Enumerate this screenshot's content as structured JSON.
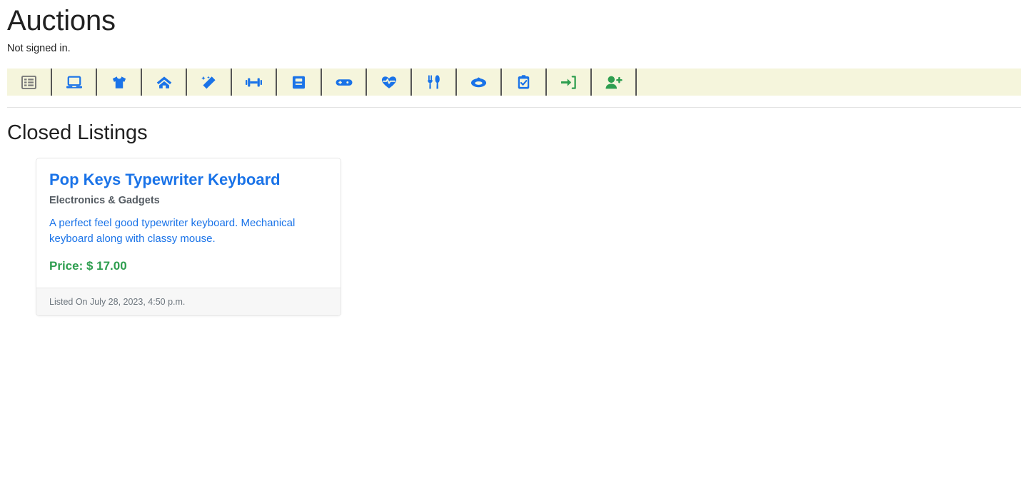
{
  "header": {
    "title": "Auctions",
    "auth_status": "Not signed in."
  },
  "navbar": {
    "background_color": "#f5f5dc",
    "divider_color": "#555555",
    "items": [
      {
        "icon": "list-alt-icon",
        "name": "nav-all-listings",
        "color": "#7a7a7a",
        "label": "All Listings"
      },
      {
        "icon": "laptop-icon",
        "name": "nav-electronics",
        "color": "#1a73e8",
        "label": "Electronics & Gadgets"
      },
      {
        "icon": "tshirt-icon",
        "name": "nav-fashion",
        "color": "#1a73e8",
        "label": "Fashion & Apparel"
      },
      {
        "icon": "home-icon",
        "name": "nav-home-garden",
        "color": "#1a73e8",
        "label": "Home & Garden"
      },
      {
        "icon": "magic-wand-icon",
        "name": "nav-beauty",
        "color": "#1a73e8",
        "label": "Beauty & Personal Care"
      },
      {
        "icon": "dumbbell-icon",
        "name": "nav-sports-fitness",
        "color": "#1a73e8",
        "label": "Sports & Fitness"
      },
      {
        "icon": "book-icon",
        "name": "nav-books-media",
        "color": "#1a73e8",
        "label": "Books & Media"
      },
      {
        "icon": "gamepad-icon",
        "name": "nav-toys-games",
        "color": "#1a73e8",
        "label": "Toys & Games"
      },
      {
        "icon": "heartbeat-icon",
        "name": "nav-health-wellness",
        "color": "#1a73e8",
        "label": "Health & Wellness"
      },
      {
        "icon": "utensils-icon",
        "name": "nav-food-beverages",
        "color": "#1a73e8",
        "label": "Food & Beverages"
      },
      {
        "icon": "ring-icon",
        "name": "nav-jewelry",
        "color": "#1a73e8",
        "label": "Jewelry & Accessories"
      },
      {
        "icon": "clipboard-check-icon",
        "name": "nav-closed-listings",
        "color": "#1a73e8",
        "label": "Closed Listings"
      },
      {
        "icon": "sign-in-icon",
        "name": "nav-sign-in",
        "color": "#2e9e4f",
        "label": "Sign In"
      },
      {
        "icon": "user-plus-icon",
        "name": "nav-register",
        "color": "#2e9e4f",
        "label": "Register"
      }
    ]
  },
  "main": {
    "section_heading": "Closed Listings",
    "listings": [
      {
        "title": "Pop Keys Typewriter Keyboard",
        "category": "Electronics & Gadgets",
        "description": "A perfect feel good typewriter keyboard. Mechanical keyboard along with classy mouse.",
        "price": "Price: $ 17.00",
        "listed_on": "Listed On July 28, 2023, 4:50 p.m."
      }
    ]
  },
  "colors": {
    "link_blue": "#1a73e8",
    "price_green": "#2e9e4f",
    "nav_cream": "#f5f5dc",
    "muted_gray": "#6c757d"
  }
}
